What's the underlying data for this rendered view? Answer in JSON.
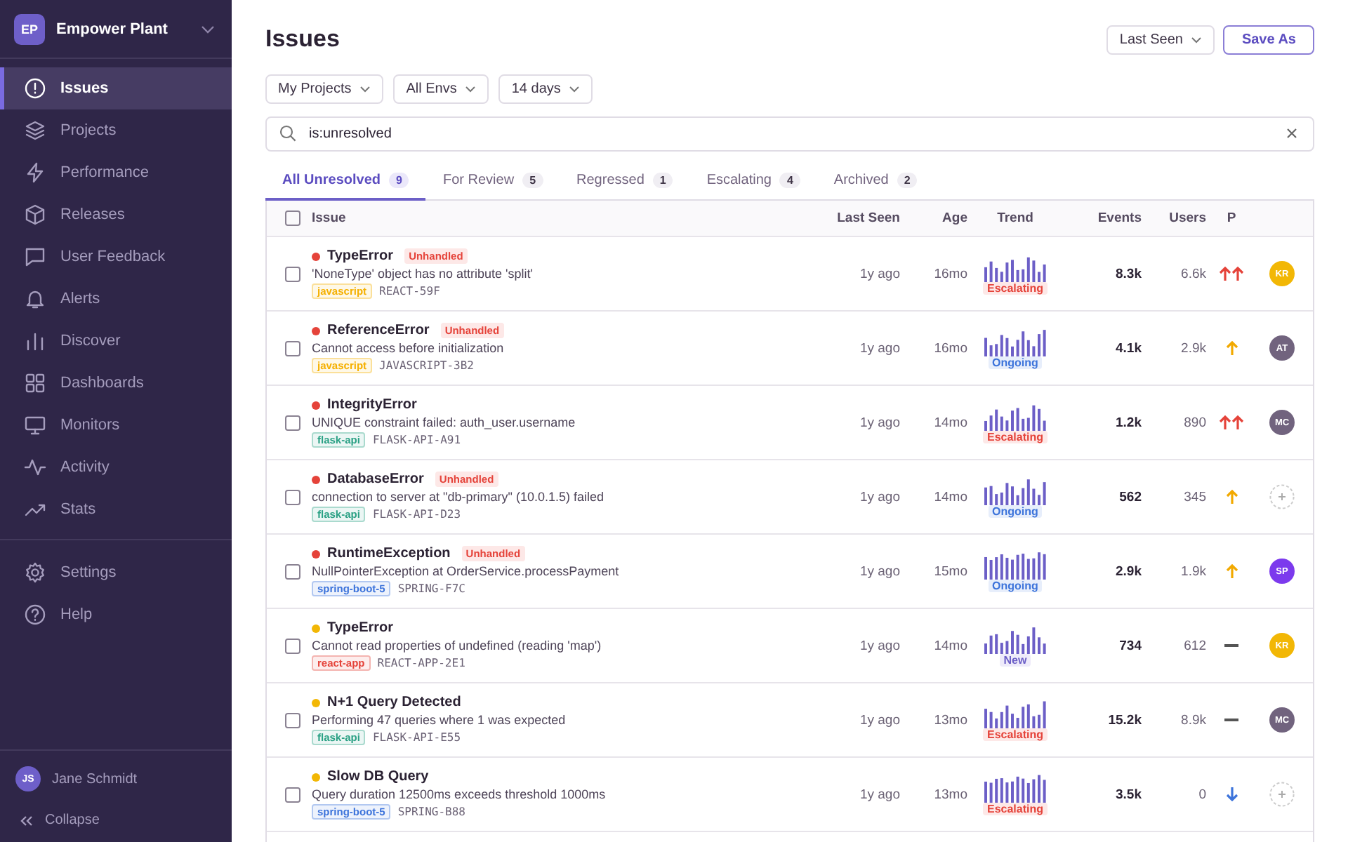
{
  "org": {
    "initials": "EP",
    "name": "Empower Plant"
  },
  "nav": [
    {
      "label": "Issues",
      "selected": true
    },
    {
      "label": "Projects",
      "selected": false
    },
    {
      "label": "Performance",
      "selected": false
    },
    {
      "label": "Releases",
      "selected": false
    },
    {
      "label": "User Feedback",
      "selected": false
    },
    {
      "label": "Alerts",
      "selected": false
    },
    {
      "label": "Discover",
      "selected": false
    },
    {
      "label": "Dashboards",
      "selected": false
    },
    {
      "label": "Monitors",
      "selected": false
    },
    {
      "label": "Activity",
      "selected": false
    },
    {
      "label": "Stats",
      "selected": false
    }
  ],
  "nav_footer": [
    {
      "label": "Settings",
      "selected": false
    },
    {
      "label": "Help",
      "selected": false
    }
  ],
  "user": {
    "initials": "JS",
    "name": "Jane Schmidt"
  },
  "collapse": "Collapse",
  "title": "Issues",
  "sort_button": "Last Seen",
  "save_button": "Save As",
  "filters": [
    "My Projects",
    "All Envs",
    "14 days"
  ],
  "search": {
    "value": "is:unresolved"
  },
  "tabs": [
    {
      "label": "All Unresolved",
      "count": "9",
      "selected": true
    },
    {
      "label": "For Review",
      "count": "5",
      "selected": false
    },
    {
      "label": "Regressed",
      "count": "1",
      "selected": false
    },
    {
      "label": "Escalating",
      "count": "4",
      "selected": false
    },
    {
      "label": "Archived",
      "count": "2",
      "selected": false
    }
  ],
  "table": {
    "select_all_checked": false,
    "columns": [
      "Issue",
      "Last Seen",
      "Age",
      "Trend",
      "Events",
      "Users",
      "P"
    ],
    "rows": [
      {
        "title": "TypeError",
        "color": "#e5433a",
        "unhandled": "Unhandled",
        "message": "'NoneType' object has no attribute 'split'",
        "tag": {
          "label": "javascript",
          "color": "#f5b000"
        },
        "short_id": "REACT-59F",
        "last_seen": "1y ago",
        "age": "16mo",
        "status": {
          "label": "Escalating",
          "kind": "escalating"
        },
        "events": "8.3k",
        "users": "6.6k",
        "checked": false,
        "priority": {
          "kind": "high"
        },
        "assignee": {
          "initials": "KR",
          "color": "#f2b705"
        }
      },
      {
        "title": "ReferenceError",
        "color": "#e5433a",
        "unhandled": "Unhandled",
        "message": "Cannot access before initialization",
        "tag": {
          "label": "javascript",
          "color": "#f5b000"
        },
        "short_id": "JAVASCRIPT-3B2",
        "last_seen": "1y ago",
        "age": "16mo",
        "status": {
          "label": "Ongoing",
          "kind": "ongoing"
        },
        "events": "4.1k",
        "users": "2.9k",
        "checked": false,
        "priority": {
          "kind": "medium"
        },
        "assignee": {
          "initials": "AT",
          "color": "#71637e"
        }
      },
      {
        "title": "IntegrityError",
        "color": "#e5433a",
        "message": "UNIQUE constraint failed: auth_user.username",
        "tag": {
          "label": "flask-api",
          "color": "#2ba185"
        },
        "short_id": "FLASK-API-A91",
        "last_seen": "1y ago",
        "age": "14mo",
        "status": {
          "label": "Escalating",
          "kind": "escalating"
        },
        "events": "1.2k",
        "users": "890",
        "checked": false,
        "priority": {
          "kind": "high"
        },
        "assignee": {
          "initials": "MC",
          "color": "#71637e"
        }
      },
      {
        "title": "DatabaseError",
        "color": "#e5433a",
        "unhandled": "Unhandled",
        "message": "connection to server at \"db-primary\" (10.0.1.5) failed",
        "tag": {
          "label": "flask-api",
          "color": "#2ba185"
        },
        "short_id": "FLASK-API-D23",
        "last_seen": "1y ago",
        "age": "14mo",
        "status": {
          "label": "Ongoing",
          "kind": "ongoing"
        },
        "events": "562",
        "users": "345",
        "checked": false,
        "priority": {
          "kind": "medium"
        }
      },
      {
        "title": "RuntimeException",
        "color": "#e5433a",
        "unhandled": "Unhandled",
        "message": "NullPointerException at OrderService.processPayment",
        "tag": {
          "label": "spring-boot-5",
          "color": "#3d74db"
        },
        "short_id": "SPRING-F7C",
        "last_seen": "1y ago",
        "age": "15mo",
        "status": {
          "label": "Ongoing",
          "kind": "ongoing"
        },
        "events": "2.9k",
        "users": "1.9k",
        "checked": false,
        "priority": {
          "kind": "medium"
        },
        "assignee": {
          "initials": "SP",
          "color": "#7c3aed"
        }
      },
      {
        "title": "TypeError",
        "color": "#f2b705",
        "message": "Cannot read properties of undefined (reading 'map')",
        "tag": {
          "label": "react-app",
          "color": "#e5433a"
        },
        "short_id": "REACT-APP-2E1",
        "last_seen": "1y ago",
        "age": "14mo",
        "status": {
          "label": "New",
          "kind": "new"
        },
        "events": "734",
        "users": "612",
        "checked": false,
        "priority": {
          "kind": "low"
        },
        "assignee": {
          "initials": "KR",
          "color": "#f2b705"
        }
      },
      {
        "title": "N+1 Query Detected",
        "color": "#f2b705",
        "message": "Performing 47 queries where 1 was expected",
        "tag": {
          "label": "flask-api",
          "color": "#2ba185"
        },
        "short_id": "FLASK-API-E55",
        "last_seen": "1y ago",
        "age": "13mo",
        "status": {
          "label": "Escalating",
          "kind": "escalating"
        },
        "events": "15.2k",
        "users": "8.9k",
        "checked": false,
        "priority": {
          "kind": "low"
        },
        "assignee": {
          "initials": "MC",
          "color": "#71637e"
        }
      },
      {
        "title": "Slow DB Query",
        "color": "#f2b705",
        "message": "Query duration 12500ms exceeds threshold 1000ms",
        "tag": {
          "label": "spring-boot-5",
          "color": "#3d74db"
        },
        "short_id": "SPRING-B88",
        "last_seen": "1y ago",
        "age": "13mo",
        "status": {
          "label": "Escalating",
          "kind": "escalating"
        },
        "events": "3.5k",
        "users": "0",
        "checked": false,
        "priority": {
          "kind": "lowest"
        }
      }
    ]
  }
}
